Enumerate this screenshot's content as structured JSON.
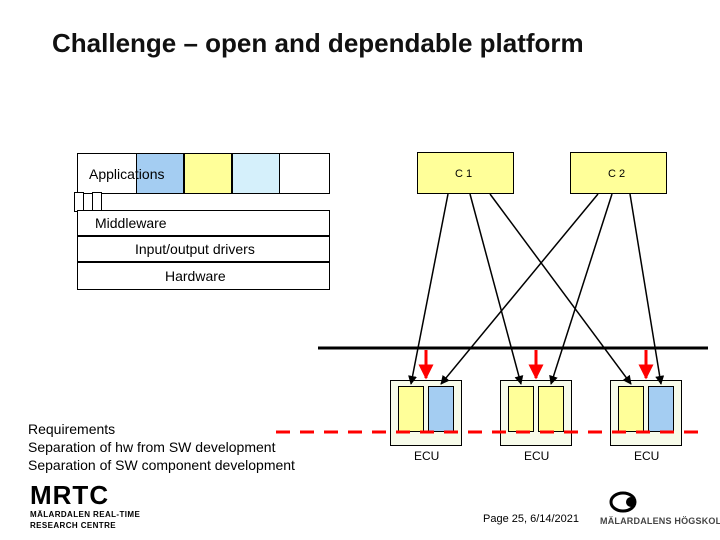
{
  "title": "Challenge – open and dependable platform",
  "stack": {
    "applications": "Applications",
    "middleware": "Middleware",
    "io_drivers": "Input/output drivers",
    "hardware": "Hardware"
  },
  "components": {
    "c1": "C 1",
    "c2": "C 2"
  },
  "nodes": {
    "ecu": "ECU"
  },
  "requirements": {
    "heading": "Requirements",
    "line1": "Separation of hw from SW development",
    "line2": "Separation of SW component development"
  },
  "footer": {
    "page": "Page 25, 6/14/2021"
  },
  "logos": {
    "mrtc": "MRTC",
    "mrtc_sub1": "MÄLARDALEN REAL-TIME",
    "mrtc_sub2": "RESEARCH CENTRE",
    "mdh": "MÄLARDALENS HÖGSKOLA"
  },
  "colors": {
    "blue": "#a4cdf2",
    "lightblue": "#d5f0fb",
    "yellow": "#ffff99",
    "red": "#ff0000",
    "ecu_pale": "#f7fbe9"
  }
}
